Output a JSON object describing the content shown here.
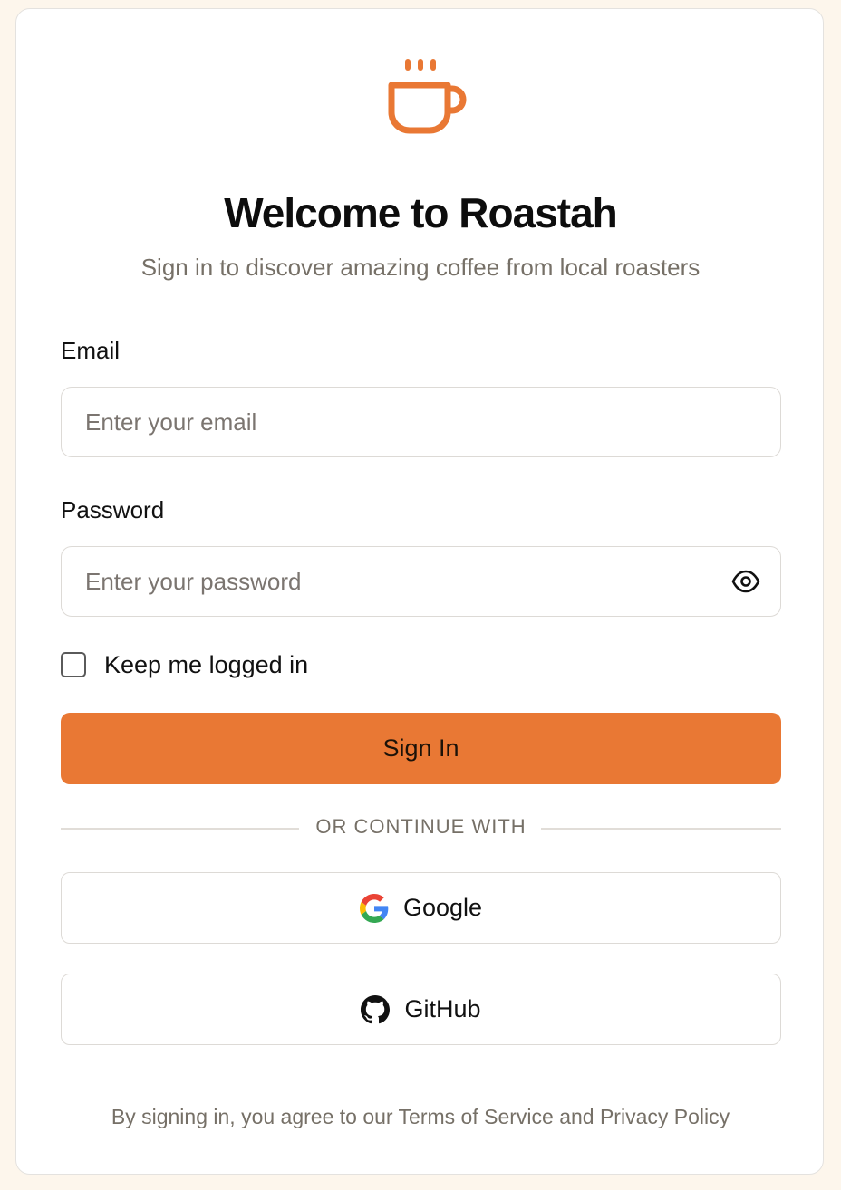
{
  "brand": {
    "accent_color": "#e97834",
    "logo_icon": "coffee-cup-icon"
  },
  "header": {
    "title": "Welcome to Roastah",
    "subtitle": "Sign in to discover amazing coffee from local roasters"
  },
  "form": {
    "email": {
      "label": "Email",
      "placeholder": "Enter your email",
      "value": ""
    },
    "password": {
      "label": "Password",
      "placeholder": "Enter your password",
      "value": "",
      "toggle_icon": "eye-icon"
    },
    "remember": {
      "label": "Keep me logged in",
      "checked": false
    },
    "submit_label": "Sign In"
  },
  "divider": {
    "text": "OR CONTINUE WITH"
  },
  "social": {
    "google": {
      "label": "Google",
      "icon": "google-icon"
    },
    "github": {
      "label": "GitHub",
      "icon": "github-icon"
    }
  },
  "footer": {
    "legal_text": "By signing in, you agree to our Terms of Service and Privacy Policy"
  }
}
